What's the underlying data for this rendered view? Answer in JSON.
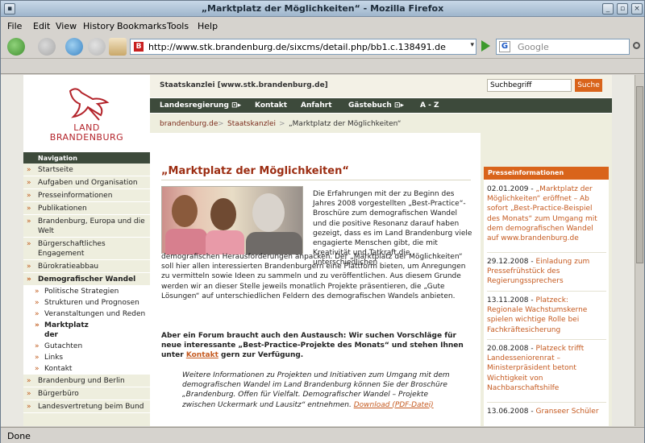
{
  "window": {
    "title": "„Marktplatz der Möglichkeiten“ - Mozilla Firefox"
  },
  "menu": [
    "File",
    "Edit",
    "View",
    "History",
    "Bookmarks",
    "Tools",
    "Help"
  ],
  "toolbar": {
    "url": "http://www.stk.brandenburg.de/sixcms/detail.php/bb1.c.138491.de",
    "favicon": "B",
    "search_engine": "G",
    "search_placeholder": "Google"
  },
  "status": "Done",
  "site": {
    "logo_line1": "LAND",
    "logo_line2": "BRANDENBURG",
    "name": "Staatskanzlei [www.stk.brandenburg.de]",
    "search_value": "Suchbegriff",
    "search_button": "Suche",
    "topnav": [
      "Landesregierung ⊡▸",
      "Kontakt",
      "Anfahrt",
      "Gästebuch ⊡▸",
      "A - Z"
    ],
    "breadcrumb": [
      "brandenburg.de",
      ">",
      "Staatskanzlei",
      ">",
      "„Marktplatz der Möglichkeiten“"
    ]
  },
  "leftnav": {
    "heading": "Navigation",
    "items": [
      {
        "label": "Startseite"
      },
      {
        "label": "Aufgaben und Organisation"
      },
      {
        "label": "Presseinformationen"
      },
      {
        "label": "Publikationen"
      },
      {
        "label": "Brandenburg, Europa und die Welt"
      },
      {
        "label": "Bürgerschaftliches Engagement"
      },
      {
        "label": "Bürokratieabbau"
      },
      {
        "label": "Demografischer Wandel"
      },
      {
        "label": "Politische Strategien"
      },
      {
        "label": "Strukturen und Prognosen"
      },
      {
        "label": "Veranstaltungen und Reden"
      },
      {
        "label": "Marktplatz der Möglichkeiten"
      },
      {
        "label": "Gutachten"
      },
      {
        "label": "Links"
      },
      {
        "label": "Kontakt"
      },
      {
        "label": "Brandenburg und Berlin"
      },
      {
        "label": "Bürgerbüro"
      },
      {
        "label": "Landesvertretung beim Bund"
      }
    ]
  },
  "main": {
    "title": "„Marktplatz der Möglichkeiten“",
    "intro": "Die Erfahrungen mit der zu Beginn des Jahres 2008 vorgestellten „Best-Practice“-Broschüre zum demografischen Wandel und die positive Resonanz darauf haben gezeigt, dass es im Land Brandenburg viele engagierte Menschen gibt, die mit Kreativität und Tatkraft die unterschiedlichen",
    "intro2": "demografischen Herausforderungen anpacken. Der „Marktplatz der Möglichkeiten“ soll hier allen interessierten Brandenburgern eine Plattform bieten, um Anregungen zu vermitteln sowie Ideen zu sammeln und zu veröffentlichen. Aus diesem Grunde werden wir an dieser Stelle jeweils monatlich Projekte präsentieren, die „Gute Lösungen“ auf unterschiedlichen Feldern des demografischen Wandels anbieten.",
    "forum_pre": "Aber ein Forum braucht auch den Austausch: Wir suchen Vorschläge für neue interessante „Best-Practice-Projekte des Monats“ und stehen Ihnen unter",
    "forum_link": "Kontakt",
    "forum_post": "gern zur Verfügung.",
    "italic_pre": "Weitere Informationen zu Projekten und Initiativen zum Umgang mit dem demografischen Wandel im Land Brandenburg können Sie der Broschüre „Brandenburg. Offen für Vielfalt. Demografischer Wandel – Projekte zwischen Uckermark und Lausitz“ entnehmen.",
    "download_link": "Download (PDF-Datei)"
  },
  "presse": {
    "heading": "Presseinformationen",
    "items": [
      {
        "date": "02.01.2009 -",
        "text": "„Marktplatz der Möglichkeiten“ eröffnet – Ab sofort „Best-Practice-Beispiel des Monats“ zum Umgang mit dem demografischen Wandel auf www.brandenburg.de"
      },
      {
        "date": "29.12.2008 -",
        "text": "Einladung zum Pressefrühstück des Regierungssprechers"
      },
      {
        "date": "13.11.2008 -",
        "text": "Platzeck: Regionale Wachstumskerne spielen wichtige Rolle bei Fachkräftesicherung"
      },
      {
        "date": "20.08.2008 -",
        "text": "Platzeck trifft Landesseniorenrat – Ministerpräsident betont Wichtigkeit von Nachbarschaftshilfe"
      },
      {
        "date": "13.06.2008 -",
        "text": "Granseer Schüler"
      }
    ]
  }
}
